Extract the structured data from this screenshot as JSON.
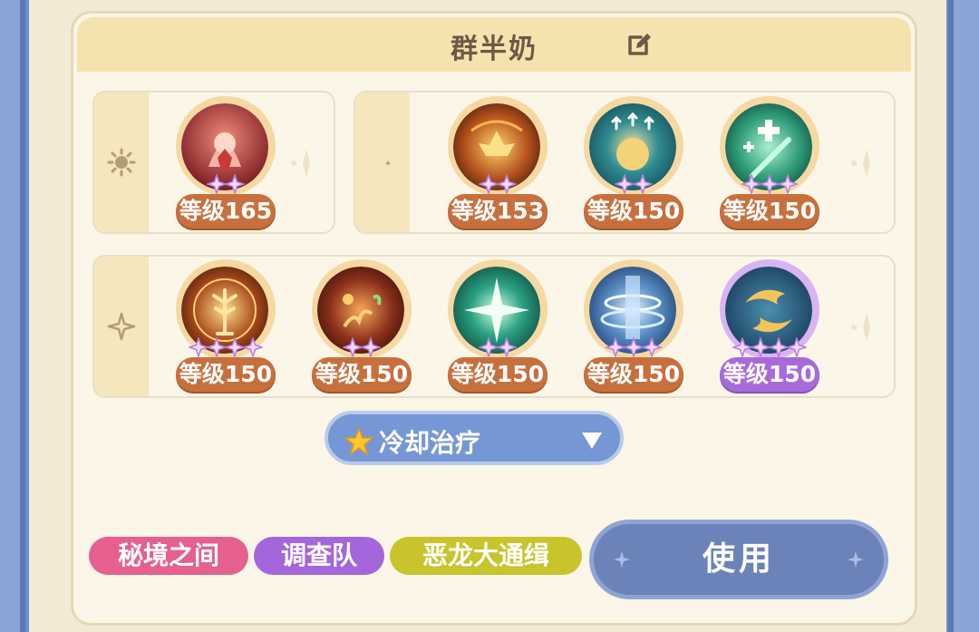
{
  "header": {
    "title": "群半奶",
    "edit_icon": "edit-icon"
  },
  "rows": [
    {
      "category_icon": "sun-icon",
      "skills": [
        {
          "level_label": "等级165",
          "stars": 2,
          "theme": "crimson"
        }
      ]
    },
    {
      "category_icon": "moon-icon",
      "skills": [
        {
          "level_label": "等级153",
          "stars": 2,
          "theme": "flame"
        },
        {
          "level_label": "等级150",
          "stars": 2,
          "theme": "teal-orb"
        },
        {
          "level_label": "等级150",
          "stars": 3,
          "theme": "green-heal"
        }
      ]
    },
    {
      "category_icon": "sparkle-icon",
      "skills": [
        {
          "level_label": "等级150",
          "stars": 4,
          "theme": "golden-tree"
        },
        {
          "level_label": "等级150",
          "stars": 2,
          "theme": "flame-bloom"
        },
        {
          "level_label": "等级150",
          "stars": 2,
          "theme": "green-star"
        },
        {
          "level_label": "等级150",
          "stars": 3,
          "theme": "blue-shield"
        },
        {
          "level_label": "等级150",
          "stars": 4,
          "theme": "purple-koi",
          "purple": true
        }
      ]
    }
  ],
  "dropdown": {
    "label": "冷却治疗",
    "icon": "star-icon"
  },
  "tags": [
    {
      "label": "秘境之间",
      "color": "#e5608e"
    },
    {
      "label": "调查队",
      "color": "#a466db"
    },
    {
      "label": "恶龙大通缉",
      "color": "#c7c42c"
    }
  ],
  "use_button": {
    "label": "使用"
  }
}
